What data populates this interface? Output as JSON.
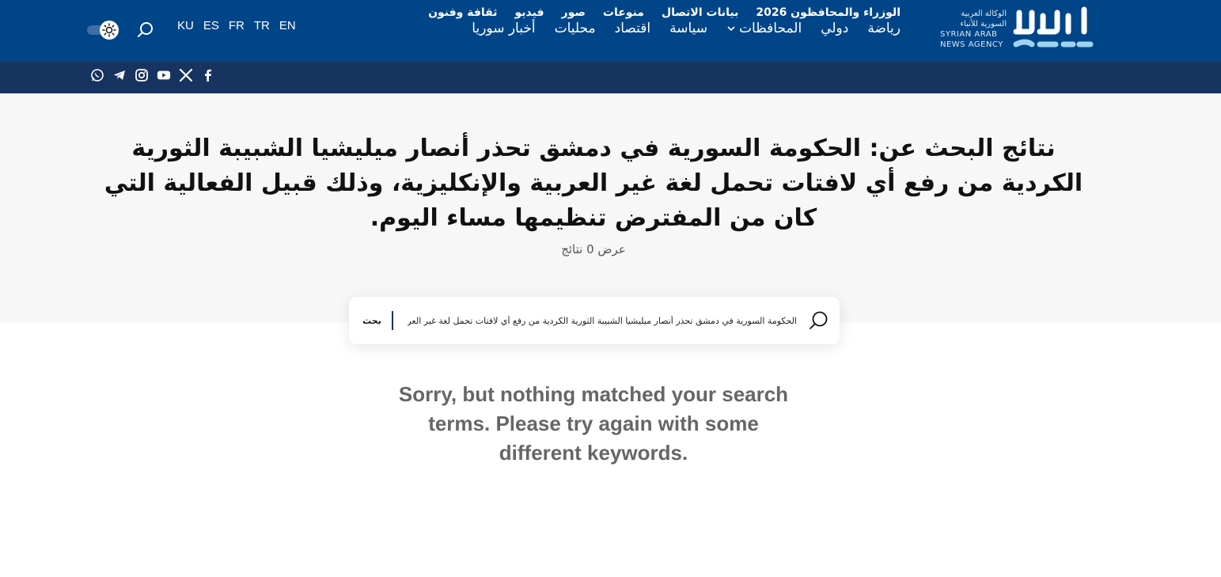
{
  "header": {
    "logo_ar_line1": "الوكالة العربية",
    "logo_ar_line2": "السورية للأنباء",
    "logo_en_line1": "SYRIAN ARAB",
    "logo_en_line2": "NEWS AGENCY",
    "logo_mark_icon": "sana-logo-icon",
    "nav": [
      {
        "label": "أخبار سوريا"
      },
      {
        "label": "محليات"
      },
      {
        "label": "اقتصاد"
      },
      {
        "label": "سياسة"
      },
      {
        "label": "المحافظات"
      },
      {
        "label": "دولي"
      },
      {
        "label": "رياضة"
      }
    ],
    "languages": [
      "KU",
      "ES",
      "FR",
      "TR",
      "EN"
    ],
    "search_icon": "search-icon",
    "theme_icon": "sun-icon"
  },
  "subnav": {
    "items": [
      {
        "label": "ثقافة وفنون"
      },
      {
        "label": "فيديو"
      },
      {
        "label": "صور"
      },
      {
        "label": "منوعات"
      },
      {
        "label": "بيانات الاتصال"
      },
      {
        "label": "الوزراء والمحافظون 2026"
      }
    ],
    "socials": [
      "facebook-icon",
      "x-icon",
      "youtube-icon",
      "instagram-icon",
      "telegram-icon",
      "whatsapp-icon"
    ]
  },
  "results": {
    "title": "نتائج البحث عن: الحكومة السورية في دمشق تحذر أنصار ميليشيا الشبيبة الثورية الكردية من رفع أي لافتات تحمل لغة غير العربية والإنكليزية، وذلك قبيل الفعالية التي كان من المفترض تنظيمها مساء اليوم.",
    "count": "عرض 0 نتائج"
  },
  "search": {
    "value": "الحكومة السورية في دمشق تحذر أنصار ميليشيا الشبيبة الثورية الكردية من رفع أي لافتات تحمل لغة غير العربية والإنكليزية، وذلك قبيل الفعالية التي كان من المفترض تنظيمها مساء اليوم.",
    "button_label": "بحث"
  },
  "message": "Sorry, but nothing matched your search terms. Please try again with some different keywords.",
  "colors": {
    "topbar": "#004588",
    "subbar": "#173360",
    "hero": "#f7f7f7"
  }
}
